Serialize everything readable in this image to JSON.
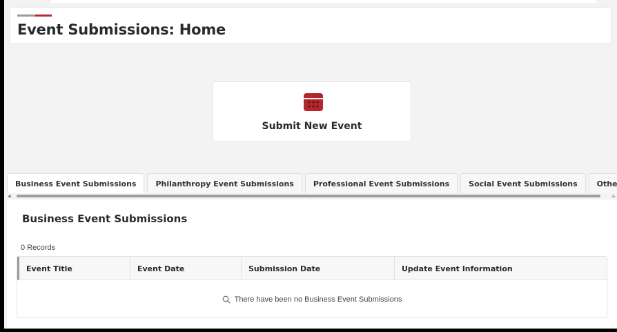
{
  "header": {
    "title": "Event Submissions: Home"
  },
  "submit": {
    "label": "Submit New Event",
    "icon": "calendar-icon"
  },
  "tabs": [
    {
      "label": "Business Event Submissions",
      "active": true
    },
    {
      "label": "Philanthropy Event Submissions",
      "active": false
    },
    {
      "label": "Professional Event Submissions",
      "active": false
    },
    {
      "label": "Social Event Submissions",
      "active": false
    },
    {
      "label": "Other Event Submissions",
      "active": false
    }
  ],
  "panel": {
    "title": "Business Event Submissions",
    "records": "0 Records",
    "columns": [
      "Event Title",
      "Event Date",
      "Submission Date",
      "Update Event Information"
    ],
    "empty_message": "There have been no Business Event Submissions",
    "empty_icon": "search-icon"
  },
  "colors": {
    "accent": "#c0272d",
    "accent_gray": "#9a9a9a"
  }
}
